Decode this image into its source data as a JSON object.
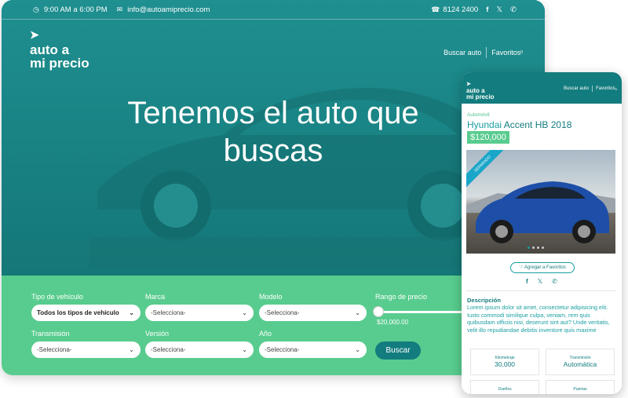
{
  "topbar": {
    "hours": "9:00 AM a 6:00 PM",
    "email": "info@autoamiprecio.com",
    "phone": "8124 2400",
    "social_icons": [
      "facebook-icon",
      "twitter-icon",
      "whatsapp-icon"
    ]
  },
  "logo": {
    "line1": "auto a",
    "line2": "mi precio"
  },
  "nav": {
    "search": "Buscar auto",
    "favorites": "Favoritos",
    "favorites_count": "0"
  },
  "hero": {
    "line1": "Tenemos el auto que",
    "line2": "buscas"
  },
  "search_form": {
    "vehicle_type": {
      "label": "Tipo de vehículo",
      "value": "Todos los tipos de vehículo"
    },
    "brand": {
      "label": "Marca",
      "value": "-Selecciona-"
    },
    "model": {
      "label": "Modelo",
      "value": "-Selecciona-"
    },
    "price_range": {
      "label": "Rango de precio",
      "value": "$20,000.00"
    },
    "transmission": {
      "label": "Transmisión",
      "value": "-Selecciona-"
    },
    "version": {
      "label": "Versión",
      "value": "-Selecciona-"
    },
    "year": {
      "label": "Año",
      "value": "-Selecciona-"
    },
    "submit": "Buscar"
  },
  "mobile": {
    "nav": {
      "search": "Buscar auto",
      "favorites": "Favoritos",
      "favorites_count": "0"
    },
    "category": "Automóvil",
    "title_brand": "Hyundai",
    "title_model": "Accent HB 2018",
    "price": "$120,000",
    "ribbon": "SEPARADO",
    "add_favorite": "Agregar a Favoritos",
    "description_title": "Descripción",
    "description": "Lorem ipsum dolor sit amet, consectetur adipisicing elit. Iusto commodi similique culpa, veniam, rem quis quibusdam officiis nisi, deserunt sint aut? Unde veritatis, velit illo repudiandae debitis inventore quis maxime",
    "specs": [
      {
        "label": "Kilometraje",
        "value": "30,000"
      },
      {
        "label": "Transmisión",
        "value": "Automática"
      },
      {
        "label": "Dueños",
        "value": ""
      },
      {
        "label": "Puertas",
        "value": ""
      }
    ]
  },
  "colors": {
    "teal": "#1e8c8d",
    "dark_teal": "#137c7e",
    "green": "#58cc8e",
    "white": "#ffffff"
  }
}
